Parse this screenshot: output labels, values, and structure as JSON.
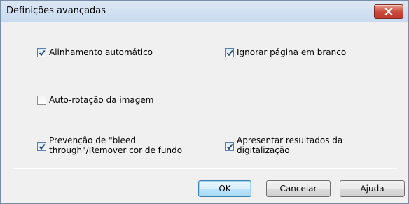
{
  "window": {
    "title": "Definições avançadas"
  },
  "options": {
    "auto_align": {
      "label": "Alinhamento automático",
      "checked": true
    },
    "ignore_blank": {
      "label": "Ignorar página em branco",
      "checked": true
    },
    "auto_rotate": {
      "label": "Auto-rotação da imagem",
      "checked": false
    },
    "bleed_through": {
      "label_line1": "Prevenção de \"bleed",
      "label_line2": "through\"/Remover cor de fundo",
      "checked": true
    },
    "show_results": {
      "label_line1": "Apresentar resultados da",
      "label_line2": "digitalização",
      "checked": true
    }
  },
  "buttons": {
    "ok": "OK",
    "cancel": "Cancelar",
    "help": "Ajuda"
  },
  "colors": {
    "titlebar": "#c9dbef",
    "close": "#c8473b",
    "default_button": "#bee6fd"
  },
  "icons": {
    "close": "close-icon",
    "check": "checkmark-icon"
  }
}
